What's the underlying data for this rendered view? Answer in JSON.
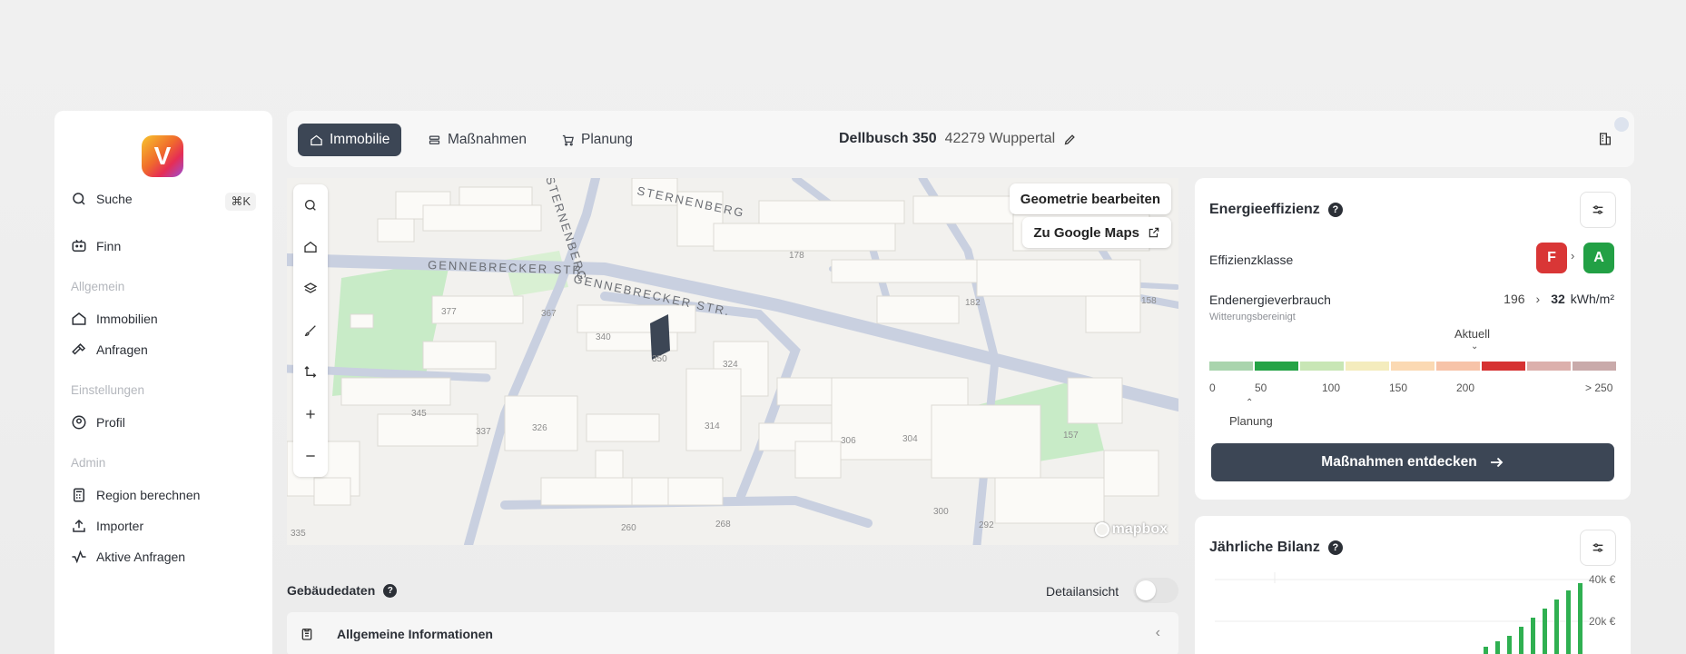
{
  "sidebar": {
    "logo_letter": "V",
    "search": {
      "label": "Suche",
      "shortcut": "⌘K"
    },
    "assistant": {
      "label": "Finn"
    },
    "sections": [
      {
        "title": "Allgemein",
        "items": [
          {
            "label": "Immobilien",
            "icon": "home-icon"
          },
          {
            "label": "Anfragen",
            "icon": "hammer-icon"
          }
        ]
      },
      {
        "title": "Einstellungen",
        "items": [
          {
            "label": "Profil",
            "icon": "profile-icon"
          }
        ]
      },
      {
        "title": "Admin",
        "items": [
          {
            "label": "Region berechnen",
            "icon": "calculator-icon"
          },
          {
            "label": "Importer",
            "icon": "upload-icon"
          },
          {
            "label": "Aktive Anfragen",
            "icon": "activity-icon"
          }
        ]
      }
    ]
  },
  "topbar": {
    "tabs": [
      {
        "label": "Immobilie",
        "active": true
      },
      {
        "label": "Maßnahmen",
        "active": false
      },
      {
        "label": "Planung",
        "active": false
      }
    ],
    "address_street": "Dellbusch 350",
    "address_city": "42279 Wuppertal"
  },
  "map": {
    "edit_geometry": "Geometrie bearbeiten",
    "google_maps": "Zu Google Maps",
    "attribution": "mapbox",
    "street_labels": [
      "GENNEBRECKER STR.",
      "GENNEBRECKER STR.",
      "STERNENBERG",
      "STERNENBERG"
    ],
    "house_numbers": [
      "377",
      "367",
      "340",
      "324",
      "345",
      "337",
      "326",
      "314",
      "306",
      "304",
      "300",
      "292",
      "268",
      "260",
      "335",
      "182",
      "178",
      "158",
      "157",
      "350"
    ]
  },
  "energy": {
    "title": "Energieeffizienz",
    "class_label": "Effizienzklasse",
    "class_from": "F",
    "class_to": "A",
    "consumption_label": "Endenergieverbrauch",
    "consumption_sub": "Witterungsbereinigt",
    "value_from": "196",
    "value_to": "32",
    "unit": "kWh/m²",
    "current_label": "Aktuell",
    "planned_label": "Planung",
    "ticks": [
      "0",
      "50",
      "100",
      "150",
      "200",
      "> 250"
    ],
    "scale_colors": [
      "#a9d4ad",
      "#24a346",
      "#c8e6b5",
      "#f4ecbd",
      "#fbd9b3",
      "#f7c3a8",
      "#d63232",
      "#dcb0ac",
      "#c9aaaa"
    ],
    "cta": "Maßnahmen entdecken"
  },
  "balance": {
    "title": "Jährliche Bilanz",
    "y_ticks": [
      "40k €",
      "20k €"
    ]
  },
  "building_data": {
    "title": "Gebäudedaten",
    "detail_label": "Detailansicht",
    "row_label": "Allgemeine Informationen"
  }
}
